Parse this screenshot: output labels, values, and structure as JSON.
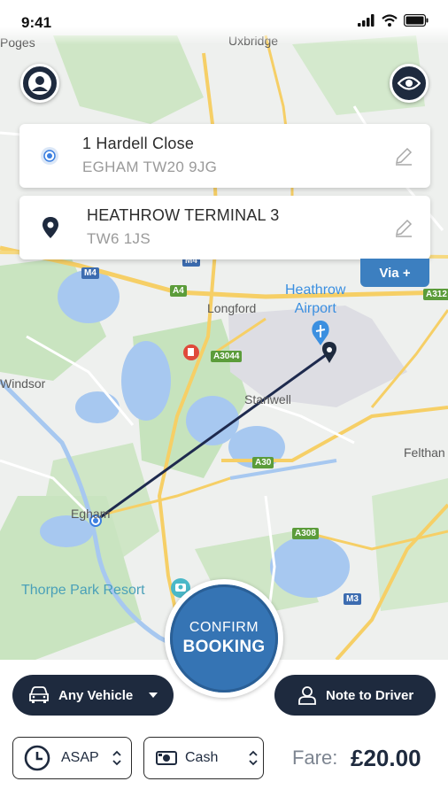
{
  "status_bar": {
    "time": "9:41"
  },
  "map": {
    "labels": {
      "poges": "Poges",
      "uxbridge": "Uxbridge",
      "longford": "Longford",
      "windsor": "Windsor",
      "stanwell": "Stanwell",
      "feltham": "Felthan",
      "egham": "Egham",
      "thorpe_park": "Thorpe Park Resort",
      "heathrow_line1": "Heathrow",
      "heathrow_line2": "Airport"
    },
    "road_badges": {
      "m4": "M4",
      "a4": "A4",
      "a3044": "A3044",
      "a30": "A30",
      "a308": "A308",
      "m3": "M3",
      "a312": "A312",
      "m4_top": "M4"
    }
  },
  "pickup": {
    "line1": "1 Hardell Close",
    "line2": "EGHAM TW20 9JG"
  },
  "destination": {
    "line1": "HEATHROW TERMINAL 3",
    "line2": "TW6 1JS"
  },
  "via_button": "Via +",
  "confirm": {
    "line1": "CONFIRM",
    "line2": "BOOKING"
  },
  "vehicle_button": "Any Vehicle",
  "note_button": "Note to Driver",
  "time_select": "ASAP",
  "payment_select": "Cash",
  "fare": {
    "label": "Fare:",
    "value": "£20.00"
  },
  "colors": {
    "dark_navy": "#1e2a3e",
    "accent_blue": "#3574b4",
    "map_water": "#a7c8f0",
    "map_park": "#c6e3bd"
  }
}
